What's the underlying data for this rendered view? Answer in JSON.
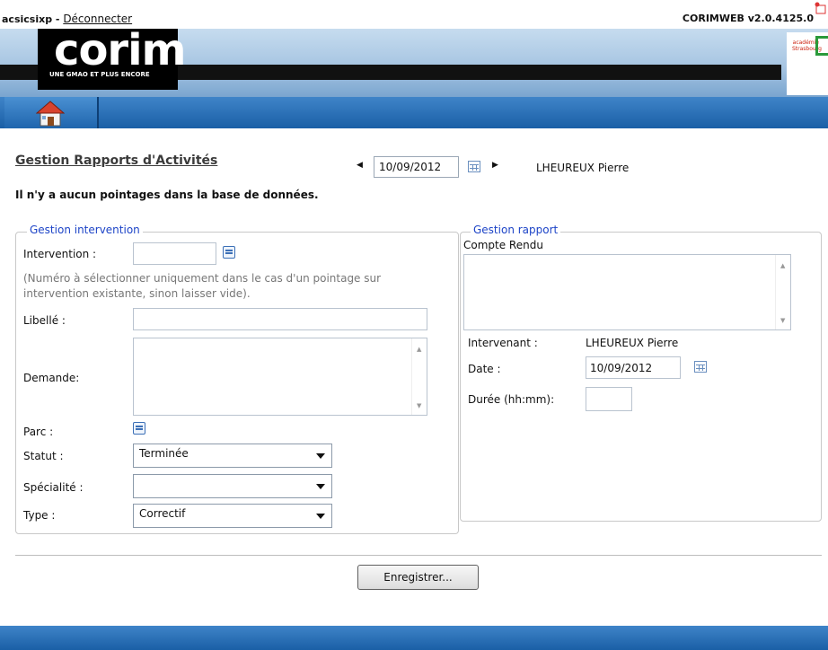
{
  "top": {
    "username": "acsicsixp",
    "separator": " - ",
    "logout_link": "Déconnecter",
    "version": "CORIMWEB v2.0.4125.0"
  },
  "banner": {
    "logo": "corim",
    "tagline": "UNE GMAO ET PLUS ENCORE",
    "academy_line1": "académie",
    "academy_line2": "Strasbourg"
  },
  "nav": {
    "home_icon": "home-icon"
  },
  "header": {
    "title": "Gestion Rapports d'Activités",
    "date": "10/09/2012",
    "user": "LHEUREUX Pierre"
  },
  "message": "Il n'y a aucun pointages dans la base de données.",
  "intervention": {
    "legend": "Gestion intervention",
    "intervention_label": "Intervention :",
    "intervention_value": "",
    "hint": "(Numéro à sélectionner uniquement dans le cas d'un pointage sur intervention existante, sinon laisser vide).",
    "libelle_label": "Libellé :",
    "libelle_value": "",
    "demande_label": "Demande:",
    "parc_label": "Parc :",
    "statut_label": "Statut :",
    "statut_value": "Terminée",
    "specialite_label": "Spécialité :",
    "specialite_value": "",
    "type_label": "Type :",
    "type_value": "Correctif"
  },
  "rapport": {
    "legend": "Gestion rapport",
    "compte_rendu_label": "Compte Rendu",
    "intervenant_label": "Intervenant :",
    "intervenant_value": "LHEUREUX Pierre",
    "date_label": "Date :",
    "date_value": "10/09/2012",
    "duree_label": "Durée (hh:mm):",
    "duree_value": ""
  },
  "actions": {
    "save_label": "Enregistrer..."
  },
  "colors": {
    "nav_blue": "#1a5fa6",
    "legend_blue": "#1d44c7"
  }
}
